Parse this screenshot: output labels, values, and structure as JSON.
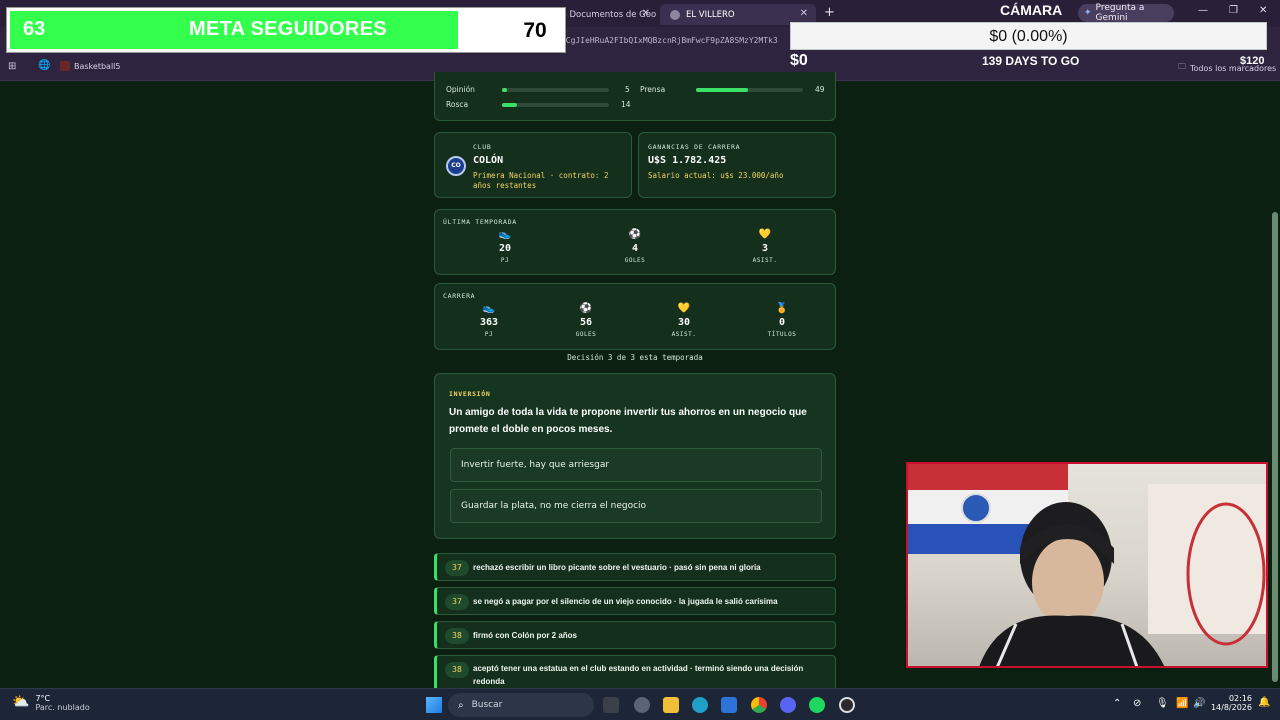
{
  "browser": {
    "tabs": [
      {
        "label": "STREAM - Documentos de Goo"
      },
      {
        "label": "EL VILLERO"
      }
    ],
    "new_tab_label": "+",
    "url_fragment": "gclid=PAcGRvCgJIeHRuA2FIbQIxMQBzcnRjBmFwcF9pZA8SMzY2MTk3",
    "gemini_label": "Pregunta a Gemini",
    "bookmarks": [
      {
        "label": "Basketball5"
      }
    ],
    "all_bookmarks_label": "Todos los marcadores"
  },
  "stream": {
    "followers_current": "63",
    "followers_title": "META SEGUIDORES",
    "followers_goal": "70",
    "followers_progress": 0.9,
    "camera_label": "CÁMARA",
    "percent_text": "$0 (0.00%)",
    "money": "$0",
    "days_to_go": "139 DAYS TO GO",
    "goal_amount": "$120"
  },
  "game": {
    "attributes": [
      {
        "label": "Opinión",
        "value": "5",
        "level": 0.05
      },
      {
        "label": "Prensa",
        "value": "49",
        "level": 0.49
      },
      {
        "label": "Rosca",
        "value": "14",
        "level": 0.14
      }
    ],
    "club": {
      "label": "CLUB",
      "badge": "CO",
      "name": "COLÓN",
      "info": "Primera Nacional · contrato: 2 años restantes"
    },
    "earnings": {
      "label": "GANANCIAS DE CARRERA",
      "value": "U$S 1.782.425",
      "salary": "Salario actual: u$s 23.000/año"
    },
    "last_season": {
      "label": "ÚLTIMA TEMPORADA",
      "stats": [
        {
          "icon": "boot-icon",
          "glyph": "👟",
          "value": "20",
          "caption": "PJ"
        },
        {
          "icon": "ball-icon",
          "glyph": "⚽",
          "value": "4",
          "caption": "GOLES"
        },
        {
          "icon": "heart-icon",
          "glyph": "💛",
          "value": "3",
          "caption": "ASIST."
        }
      ]
    },
    "career": {
      "label": "CARRERA",
      "stats": [
        {
          "icon": "boot-icon",
          "glyph": "👟",
          "value": "363",
          "caption": "PJ"
        },
        {
          "icon": "ball-icon",
          "glyph": "⚽",
          "value": "56",
          "caption": "GOLES"
        },
        {
          "icon": "heart-icon",
          "glyph": "💛",
          "value": "30",
          "caption": "ASIST."
        },
        {
          "icon": "medal-icon",
          "glyph": "🏅",
          "value": "0",
          "caption": "TÍTULOS"
        }
      ]
    },
    "decision_counter": "Decisión 3 de 3 esta temporada",
    "event": {
      "category": "INVERSIÓN",
      "question": "Un amigo de toda la vida te propone invertir tus ahorros en un negocio que promete el doble en pocos meses.",
      "options": [
        "Invertir fuerte, hay que arriesgar",
        "Guardar la plata, no me cierra el negocio"
      ]
    },
    "history": [
      {
        "age": "37",
        "text": "rechazó escribir un libro picante sobre el vestuario · pasó sin pena ni gloria"
      },
      {
        "age": "37",
        "text": "se negó a pagar por el silencio de un viejo conocido · la jugada le salió carísima"
      },
      {
        "age": "38",
        "text": "firmó con Colón por 2 años"
      },
      {
        "age": "38",
        "text": "aceptó tener una estatua en el club estando en actividad · terminó siendo una decisión redonda"
      }
    ]
  },
  "taskbar": {
    "weather_temp": "7°C",
    "weather_desc": "Parc. nublado",
    "search_placeholder": "Buscar",
    "time": "02:16",
    "date": "14/8/2026"
  },
  "colors": {
    "page_bg": "#0c2012",
    "card_bg": "#14301d",
    "accent_green": "#3be069",
    "gold": "#f4d35e",
    "followers_green": "#33ff4d"
  }
}
